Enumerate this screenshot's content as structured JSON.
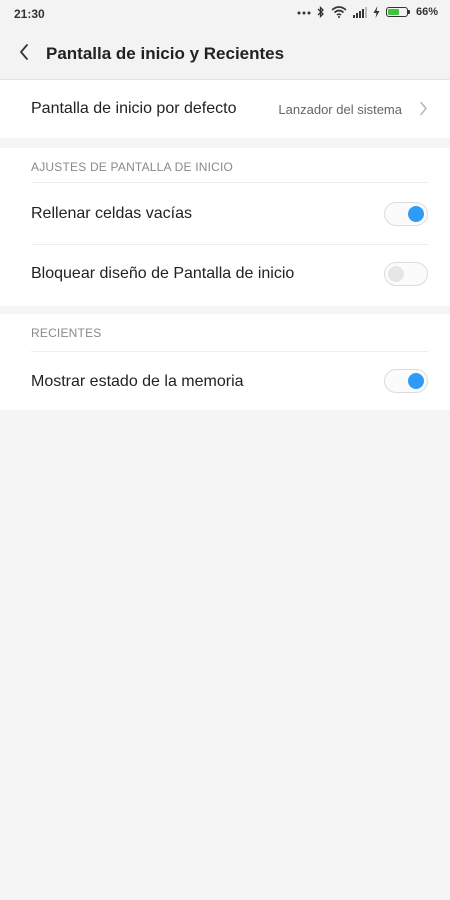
{
  "status_bar": {
    "time": "21:30",
    "battery_percent": "66%",
    "battery_level": 0.66,
    "icons": [
      "more-dots-icon",
      "bluetooth-icon",
      "wifi-icon",
      "signal-icon",
      "charging-icon",
      "battery-icon"
    ]
  },
  "header": {
    "title": "Pantalla de inicio y Recientes",
    "back_icon": "chevron-left-icon"
  },
  "default_launcher": {
    "label": "Pantalla de inicio por defecto",
    "value": "Lanzador del sistema",
    "chevron_icon": "chevron-right-icon"
  },
  "home_section": {
    "header": "AJUSTES DE PANTALLA DE INICIO",
    "items": [
      {
        "label": "Rellenar celdas vacías",
        "enabled": true
      },
      {
        "label": "Bloquear diseño de Pantalla de inicio",
        "enabled": false
      }
    ]
  },
  "recents_section": {
    "header": "RECIENTES",
    "items": [
      {
        "label": "Mostrar estado de la memoria",
        "enabled": true
      }
    ]
  },
  "colors": {
    "toggle_on": "#2e9bf6",
    "toggle_off": "#e6e6e6",
    "battery": "#3ec43e",
    "background": "#f5f5f5"
  }
}
